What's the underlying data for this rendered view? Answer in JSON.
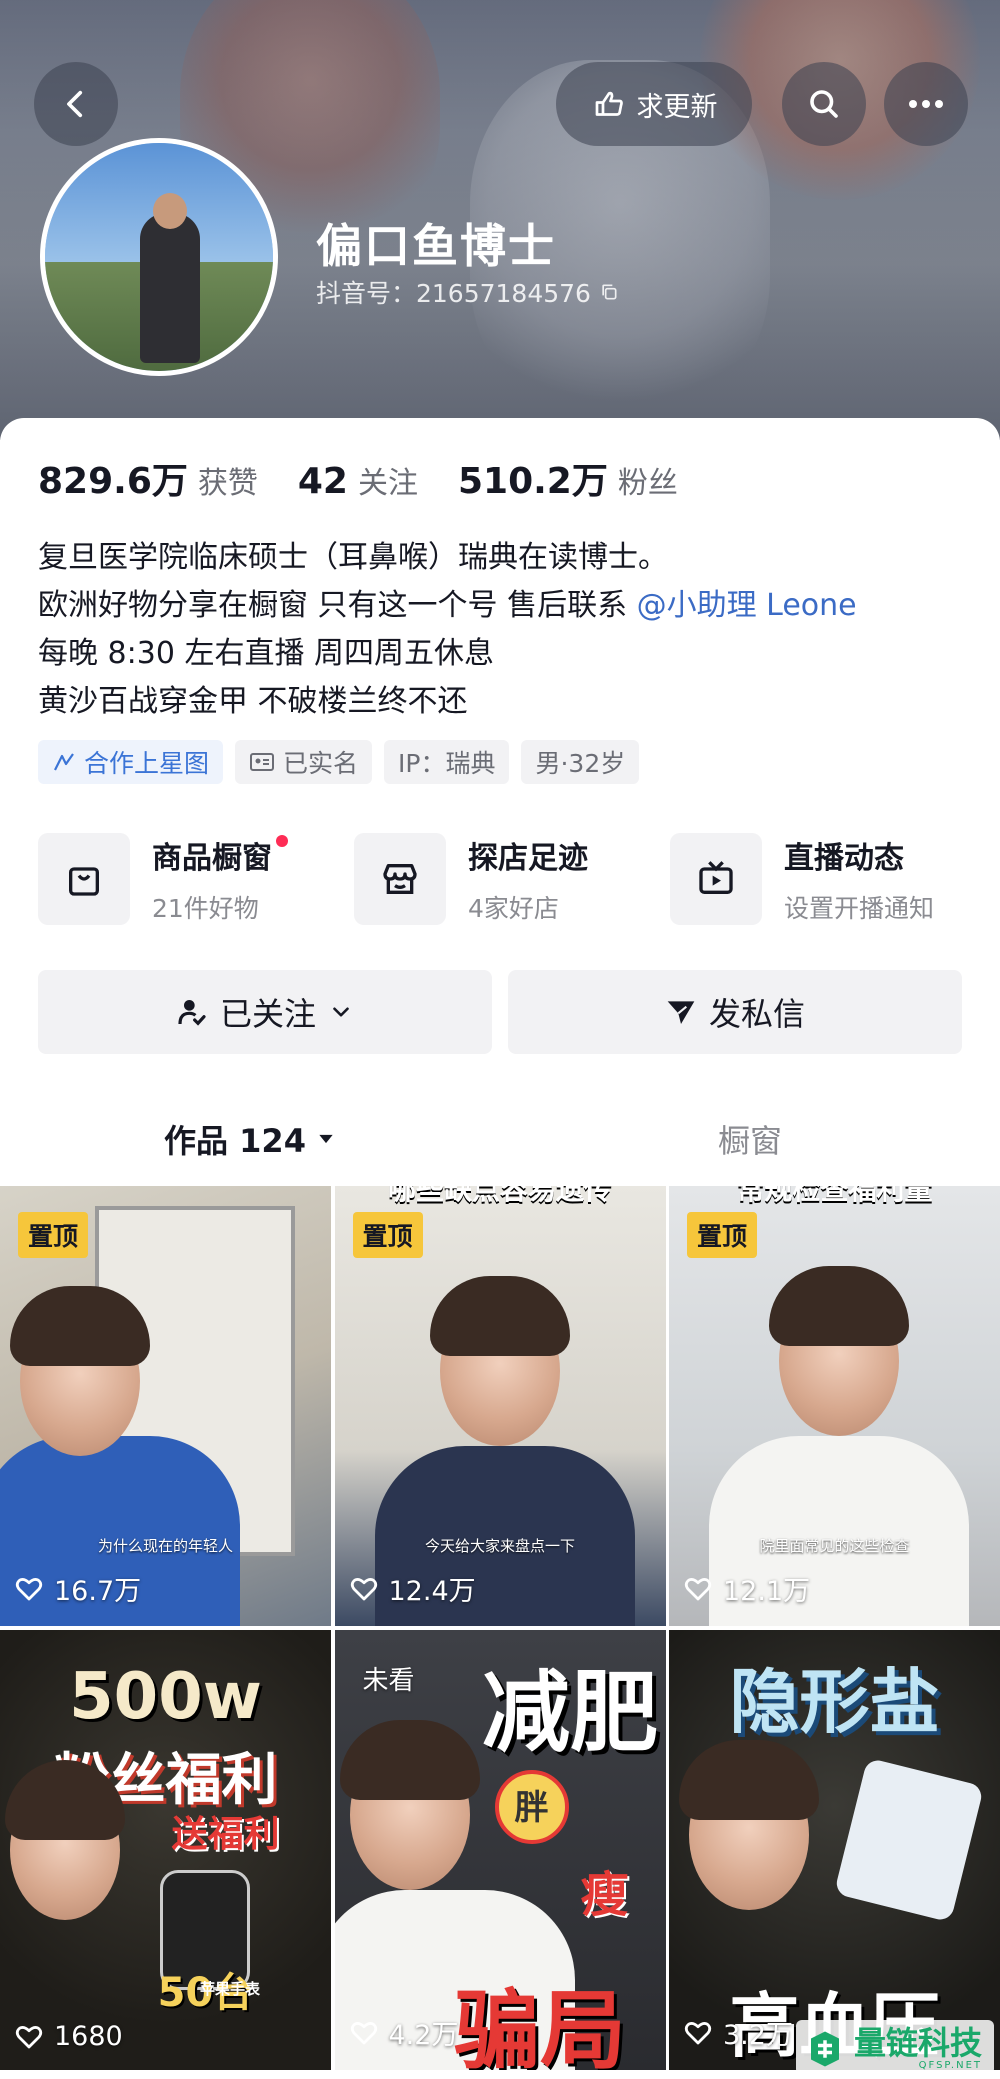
{
  "header": {
    "back_label": "",
    "update_label": "求更新",
    "nickname": "偏口鱼博士",
    "douyin_id": "抖音号：21657184576"
  },
  "stats": [
    {
      "num": "829.6万",
      "label": "获赞"
    },
    {
      "num": "42",
      "label": "关注"
    },
    {
      "num": "510.2万",
      "label": "粉丝"
    }
  ],
  "bio": {
    "line1": "复旦医学院临床硕士（耳鼻喉）瑞典在读博士。",
    "line2_prefix": "欧洲好物分享在橱窗 只有这一个号 售后联系",
    "line2_mention": "@小助理 Leone",
    "line3": "每晚 8:30 左右直播 周四周五休息",
    "line4": "黄沙百战穿金甲 不破楼兰终不还"
  },
  "tags": [
    {
      "label": "合作上星图",
      "icon": "star-map-icon"
    },
    {
      "label": "已实名",
      "icon": "id-card-icon"
    },
    {
      "label": "IP：瑞典"
    },
    {
      "label": "男·32岁"
    }
  ],
  "services": [
    {
      "title": "商品橱窗",
      "sub": "21件好物",
      "icon": "shopping-bag-icon",
      "dot": true
    },
    {
      "title": "探店足迹",
      "sub": "4家好店",
      "icon": "store-icon",
      "dot": false
    },
    {
      "title": "直播动态",
      "sub": "设置开播通知",
      "icon": "tv-icon",
      "dot": false
    }
  ],
  "actions": {
    "follow_label": "已关注",
    "message_label": "发私信"
  },
  "tabs": {
    "works_label": "作品 124",
    "showcase_label": "橱窗"
  },
  "videos": [
    {
      "badge": "置顶",
      "likes": "16.7万",
      "caption": "为什么现在的年轻人"
    },
    {
      "badge": "置顶",
      "likes": "12.4万",
      "caption": "今天给大家来盘点一下",
      "top_title": "哪些缺点容易遗传"
    },
    {
      "badge": "置顶",
      "likes": "12.1万",
      "caption": "院里面常见的这些检查",
      "top_title": "常规检查福利量"
    },
    {
      "likes": "1680",
      "title_a": "500w",
      "title_b": "粉丝福利",
      "title_c": "送福利",
      "title_d": "50台",
      "title_e": "苹果手表"
    },
    {
      "unseen": "未看",
      "likes": "4.2万",
      "title_a": "减肥",
      "title_b": "胖",
      "title_c": "瘦",
      "title_d": "骗局"
    },
    {
      "likes": "3.2万",
      "title_a": "隐形盐",
      "title_d": "高血压"
    }
  ],
  "watermark": {
    "text": "量链科技",
    "sub": "QFSP.NET"
  },
  "colors": {
    "accent_red": "#fe2c55",
    "pin_yellow": "#f6c63b",
    "mention_blue": "#3b6bc5",
    "watermark_green": "#1aa86a"
  }
}
